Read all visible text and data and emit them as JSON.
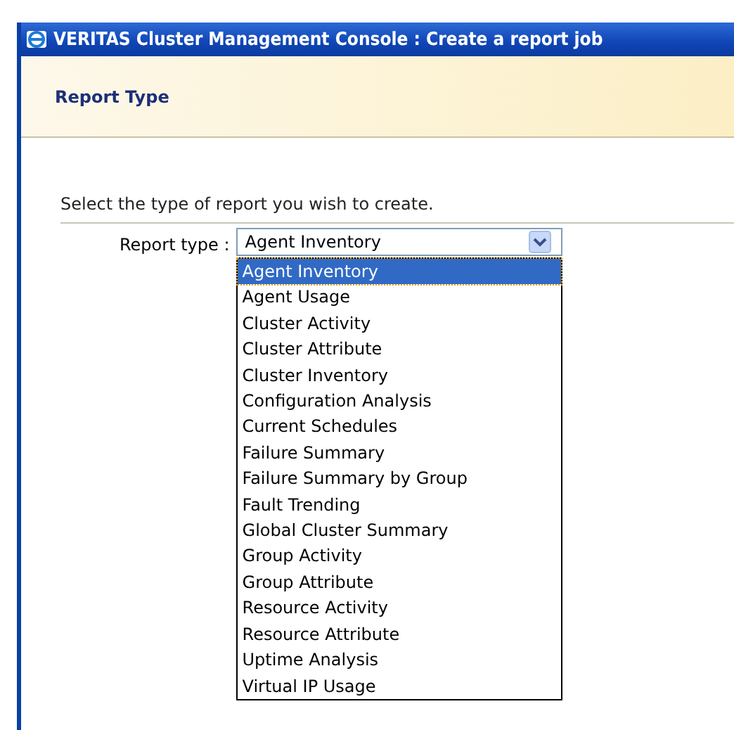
{
  "window": {
    "title": "VERITAS Cluster Management Console : Create a report job"
  },
  "header": {
    "title": "Report Type"
  },
  "instruction": "Select the type of report you wish to create.",
  "report_type": {
    "label": "Report type :",
    "value": "Agent Inventory",
    "expanded": true,
    "options": [
      {
        "label": "Agent Inventory",
        "selected": true
      },
      {
        "label": "Agent Usage",
        "selected": false
      },
      {
        "label": "Cluster Activity",
        "selected": false
      },
      {
        "label": "Cluster Attribute",
        "selected": false
      },
      {
        "label": "Cluster Inventory",
        "selected": false
      },
      {
        "label": "Configuration Analysis",
        "selected": false
      },
      {
        "label": "Current Schedules",
        "selected": false
      },
      {
        "label": "Failure Summary",
        "selected": false
      },
      {
        "label": "Failure Summary by Group",
        "selected": false
      },
      {
        "label": "Fault Trending",
        "selected": false
      },
      {
        "label": "Global Cluster Summary",
        "selected": false
      },
      {
        "label": "Group Activity",
        "selected": false
      },
      {
        "label": "Group Attribute",
        "selected": false
      },
      {
        "label": "Resource Activity",
        "selected": false
      },
      {
        "label": "Resource Attribute",
        "selected": false
      },
      {
        "label": "Uptime Analysis",
        "selected": false
      },
      {
        "label": "Virtual IP Usage",
        "selected": false
      }
    ]
  }
}
